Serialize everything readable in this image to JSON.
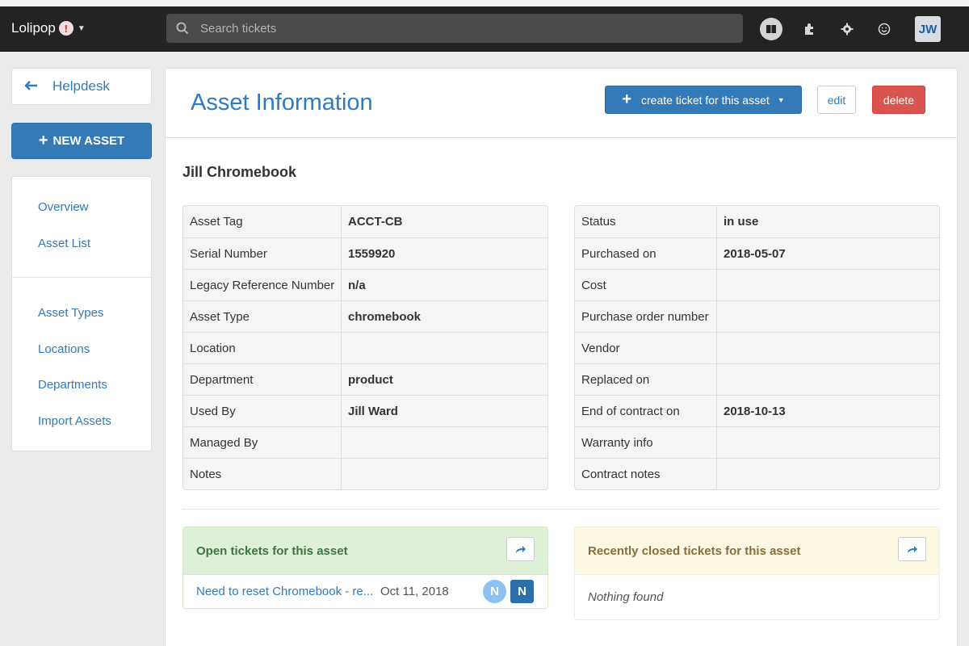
{
  "navbar": {
    "brand": "Lolipop",
    "alert_badge": "!",
    "search_placeholder": "Search tickets",
    "user_initials": "JW"
  },
  "sidebar": {
    "back_label": "Helpdesk",
    "new_asset_label": "NEW ASSET",
    "menu_group1": [
      "Overview",
      "Asset List"
    ],
    "menu_group2": [
      "Asset Types",
      "Locations",
      "Departments",
      "Import Assets"
    ]
  },
  "header": {
    "title": "Asset Information",
    "create_ticket_label": "create ticket for this asset",
    "edit_label": "edit",
    "delete_label": "delete"
  },
  "asset": {
    "name": "Jill Chromebook",
    "left_table": [
      {
        "label": "Asset Tag",
        "value": "ACCT-CB"
      },
      {
        "label": "Serial Number",
        "value": "1559920"
      },
      {
        "label": "Legacy Reference Number",
        "value": "n/a"
      },
      {
        "label": "Asset Type",
        "value": "chromebook"
      },
      {
        "label": "Location",
        "value": ""
      },
      {
        "label": "Department",
        "value": "product"
      },
      {
        "label": "Used By",
        "value": "Jill Ward"
      },
      {
        "label": "Managed By",
        "value": ""
      },
      {
        "label": "Notes",
        "value": ""
      }
    ],
    "right_table": [
      {
        "label": "Status",
        "value": "in use"
      },
      {
        "label": "Purchased on",
        "value": "2018-05-07"
      },
      {
        "label": "Cost",
        "value": ""
      },
      {
        "label": "Purchase order number",
        "value": ""
      },
      {
        "label": "Vendor",
        "value": ""
      },
      {
        "label": "Replaced on",
        "value": ""
      },
      {
        "label": "End of contract on",
        "value": "2018-10-13"
      },
      {
        "label": "Warranty info",
        "value": ""
      },
      {
        "label": "Contract notes",
        "value": ""
      }
    ]
  },
  "open_tickets": {
    "title": "Open tickets for this asset",
    "items": [
      {
        "subject": "Need to reset Chromebook - re...",
        "date": "Oct 11, 2018",
        "badge1": "N",
        "badge2": "N"
      }
    ]
  },
  "closed_tickets": {
    "title": "Recently closed tickets for this asset",
    "empty_text": "Nothing found"
  },
  "colors": {
    "navbar_bg": "#232323",
    "primary": "#337ab7",
    "danger": "#d9534f",
    "success_bg": "#dff0d8",
    "warning_bg": "#fcf8e3"
  }
}
